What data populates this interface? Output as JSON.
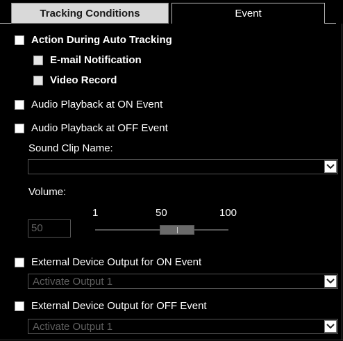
{
  "tabs": {
    "tracking_conditions": "Tracking Conditions",
    "event": "Event"
  },
  "event": {
    "action_during_auto_tracking": {
      "label": "Action During Auto Tracking",
      "checked": false
    },
    "email_notification": {
      "label": "E-mail Notification",
      "checked": false
    },
    "video_record": {
      "label": "Video Record",
      "checked": false
    },
    "audio_on": {
      "label": "Audio Playback at ON Event",
      "checked": false
    },
    "audio_off": {
      "label": "Audio Playback at OFF Event",
      "checked": false
    },
    "sound_clip_label": "Sound Clip Name:",
    "sound_clip_value": "",
    "volume_label": "Volume:",
    "volume_value": "50",
    "volume_min": "1",
    "volume_mid": "50",
    "volume_max": "100",
    "volume_level": 50,
    "ext_on": {
      "label": "External Device Output for ON Event",
      "checked": false
    },
    "ext_on_select": "Activate Output 1",
    "ext_off": {
      "label": "External Device Output for OFF Event",
      "checked": false
    },
    "ext_off_select": "Activate Output 1"
  },
  "colors": {
    "background": "#000000",
    "tab_inactive_bg": "#d9d9d9",
    "disabled_text": "#606060"
  },
  "icons": {
    "dropdown": "chevron-down-icon"
  }
}
